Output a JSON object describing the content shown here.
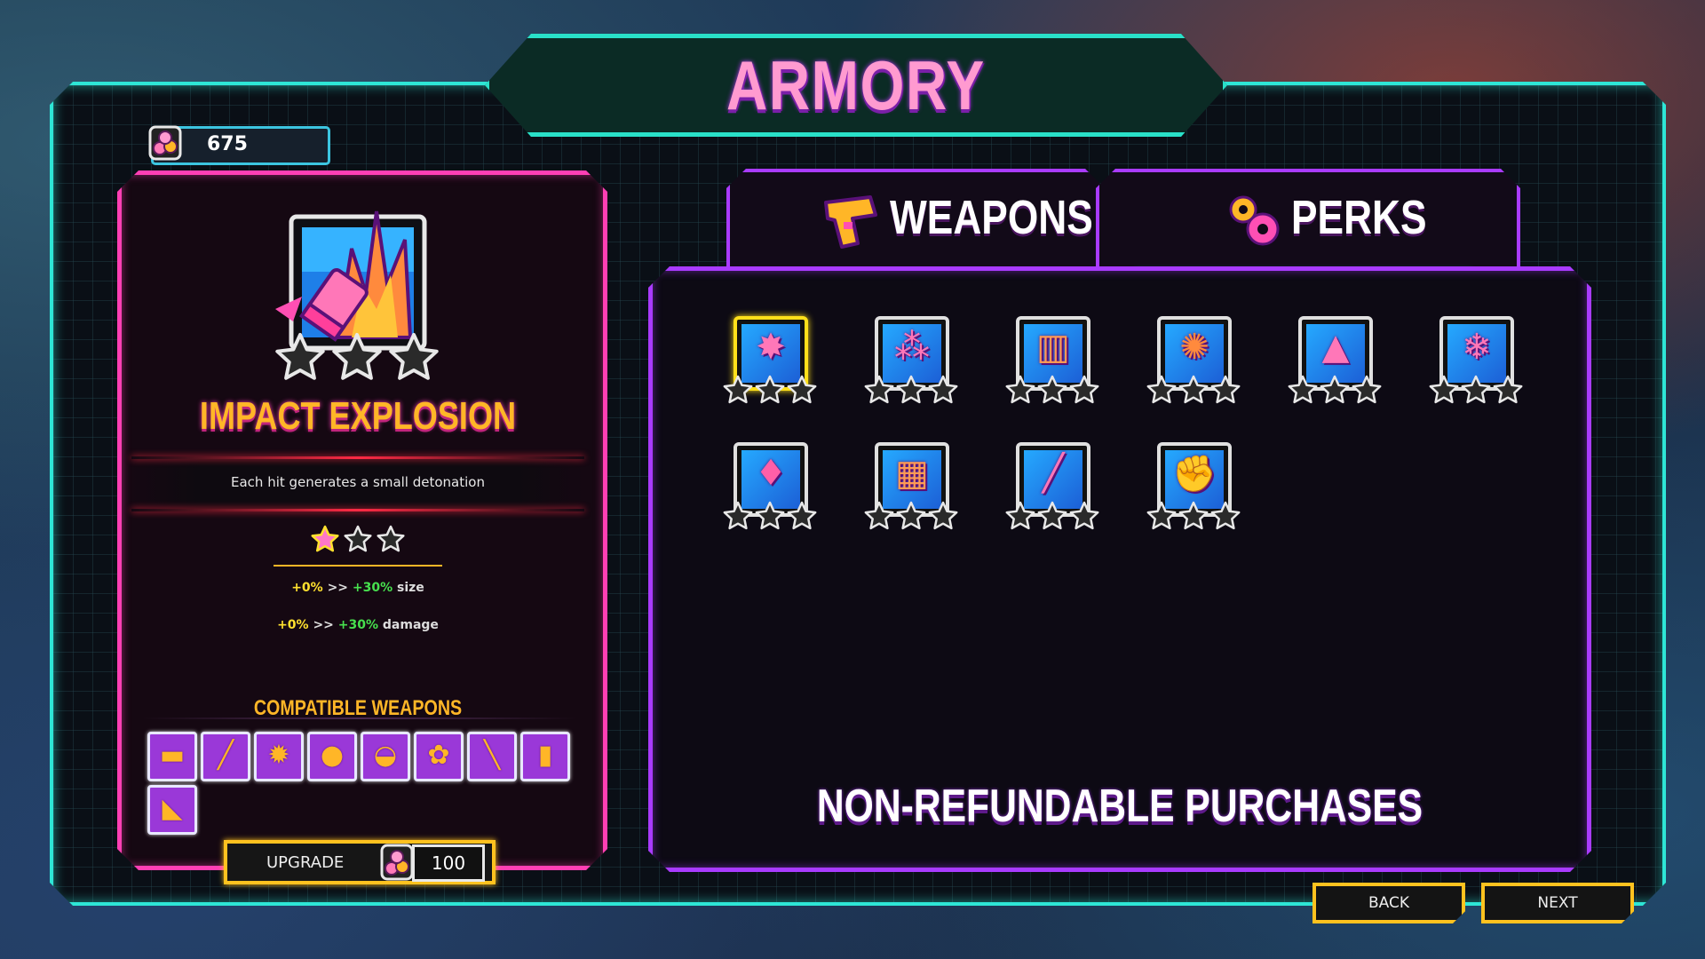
{
  "title": "ARMORY",
  "currency": {
    "amount": "675",
    "icon": "coin-pile-icon"
  },
  "selected_perk": {
    "name": "IMPACT EXPLOSION",
    "description": "Each hit generates a small detonation",
    "level": 1,
    "max_level": 3,
    "stats": [
      {
        "from": "+0%",
        "sep": ">>",
        "to": "+30%",
        "label": "size"
      },
      {
        "from": "+0%",
        "sep": ">>",
        "to": "+30%",
        "label": "damage"
      }
    ]
  },
  "compatible": {
    "title": "COMPATIBLE WEAPONS",
    "weapons": [
      "shotgun-icon",
      "assault-rifle-icon",
      "saw-blade-icon",
      "grenade-icon",
      "mine-icon",
      "revolver-cylinder-icon",
      "launcher-icon",
      "flask-icon",
      "pistol-icon"
    ]
  },
  "upgrade": {
    "label": "UPGRADE",
    "cost": "100"
  },
  "tabs": [
    {
      "label": "WEAPONS",
      "icon": "pistol-icon",
      "active": false
    },
    {
      "label": "PERKS",
      "icon": "gears-icon",
      "active": true
    }
  ],
  "perks": [
    {
      "icon": "impact-explosion-icon",
      "stars": 0,
      "selected": true
    },
    {
      "icon": "multi-bullet-icon",
      "stars": 0
    },
    {
      "icon": "bullet-row-icon",
      "stars": 0
    },
    {
      "icon": "fire-burst-icon",
      "stars": 0
    },
    {
      "icon": "fire-bullet-icon",
      "stars": 0
    },
    {
      "icon": "ice-bullet-icon",
      "stars": 0
    },
    {
      "icon": "water-drops-icon",
      "stars": 0
    },
    {
      "icon": "bullet-fire-stack-icon",
      "stars": 0
    },
    {
      "icon": "piercing-bullet-icon",
      "stars": 0
    },
    {
      "icon": "strength-arm-icon",
      "stars": 0
    }
  ],
  "notice": "NON-REFUNDABLE PURCHASES",
  "nav": {
    "back": "BACK",
    "next": "NEXT"
  },
  "colors": {
    "teal": "#2ee6d6",
    "pink": "#ff3fb4",
    "purple": "#a93bff",
    "gold": "#ffb627",
    "green": "#47e04e"
  }
}
